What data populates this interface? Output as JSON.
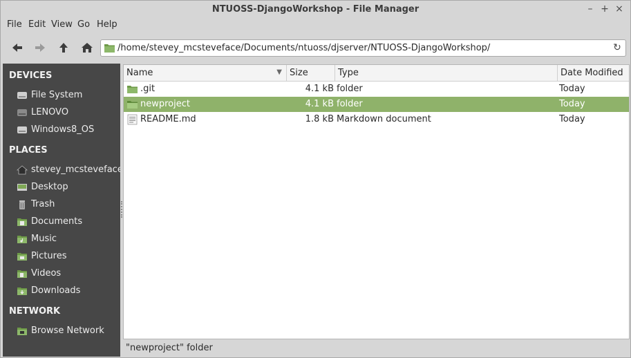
{
  "window": {
    "title": "NTUOSS-DjangoWorkshop - File Manager",
    "controls": {
      "minimize": "–",
      "maximize": "+",
      "close": "×"
    }
  },
  "menubar": [
    "File",
    "Edit",
    "View",
    "Go",
    "Help"
  ],
  "toolbar": {
    "buttons": [
      "back-icon",
      "forward-icon",
      "up-icon",
      "home-icon"
    ],
    "location": "/home/stevey_mcsteveface/Documents/ntuoss/djserver/NTUOSS-DjangoWorkshop/",
    "reload_icon": "↻"
  },
  "sidebar": {
    "devices": {
      "header": "DEVICES",
      "items": [
        {
          "label": "File System",
          "icon": "harddisk-icon"
        },
        {
          "label": "LENOVO",
          "icon": "harddisk-icon"
        },
        {
          "label": "Windows8_OS",
          "icon": "harddisk-icon"
        }
      ]
    },
    "places": {
      "header": "PLACES",
      "items": [
        {
          "label": "stevey_mcsteveface",
          "icon": "home-folder-icon"
        },
        {
          "label": "Desktop",
          "icon": "desktop-icon"
        },
        {
          "label": "Trash",
          "icon": "trash-icon"
        },
        {
          "label": "Documents",
          "icon": "documents-folder-icon"
        },
        {
          "label": "Music",
          "icon": "music-folder-icon"
        },
        {
          "label": "Pictures",
          "icon": "pictures-folder-icon"
        },
        {
          "label": "Videos",
          "icon": "videos-folder-icon"
        },
        {
          "label": "Downloads",
          "icon": "downloads-folder-icon"
        }
      ]
    },
    "network": {
      "header": "NETWORK",
      "items": [
        {
          "label": "Browse Network",
          "icon": "network-icon"
        }
      ]
    }
  },
  "filelist": {
    "columns": [
      "Name",
      "Size",
      "Type",
      "Date Modified"
    ],
    "sort_indicator": "▼",
    "rows": [
      {
        "name": ".git",
        "size": "4.1 kB",
        "type": "folder",
        "date": "Today",
        "icon": "folder-icon",
        "selected": false
      },
      {
        "name": "newproject",
        "size": "4.1 kB",
        "type": "folder",
        "date": "Today",
        "icon": "folder-icon",
        "selected": true
      },
      {
        "name": "README.md",
        "size": "1.8 kB",
        "type": "Markdown document",
        "date": "Today",
        "icon": "text-file-icon",
        "selected": false
      }
    ]
  },
  "statusbar": {
    "text": "\"newproject\" folder"
  },
  "colors": {
    "selection": "#8fb26a",
    "sidebar_bg": "#474747",
    "folder_green": "#8db86a"
  }
}
